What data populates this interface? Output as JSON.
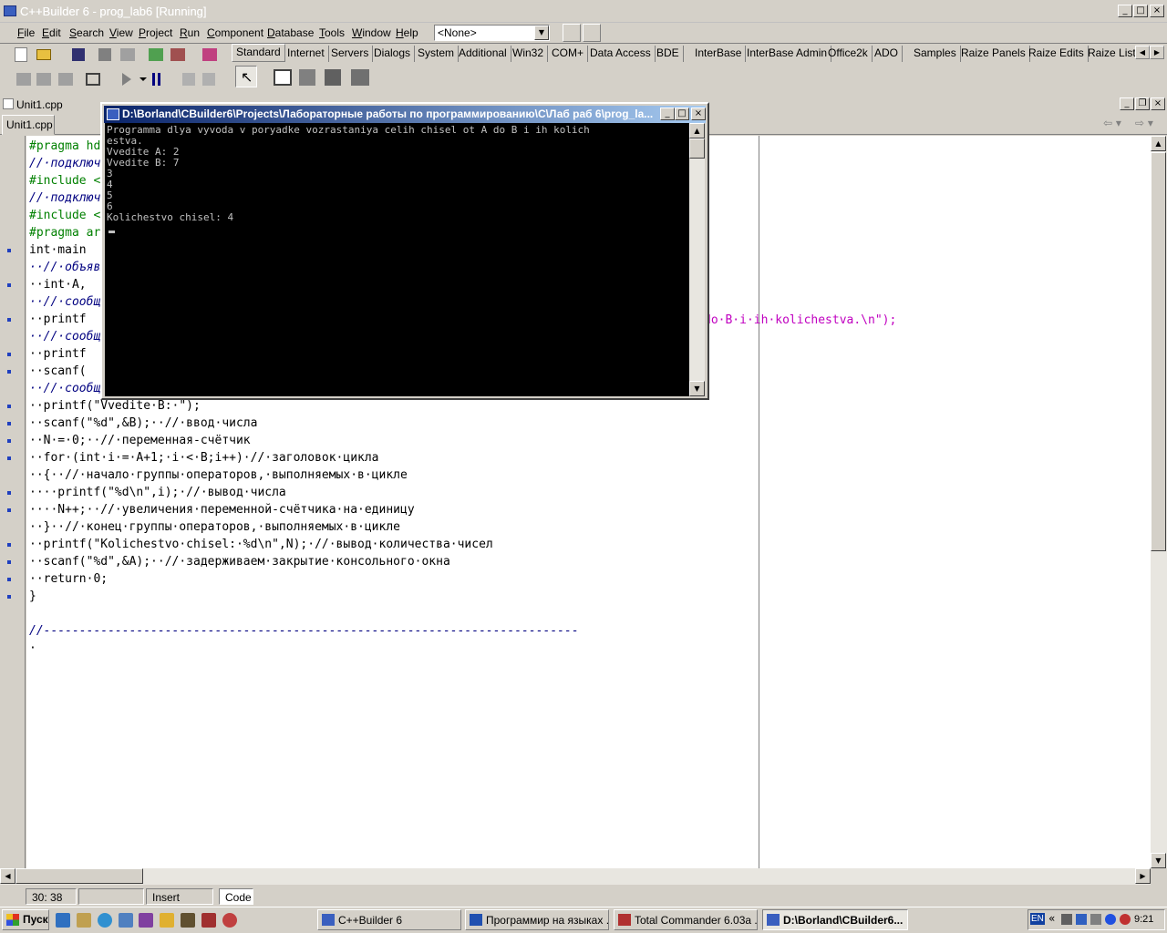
{
  "window": {
    "title": "C++Builder 6 - prog_lab6 [Running]"
  },
  "menu": [
    "File",
    "Edit",
    "Search",
    "View",
    "Project",
    "Run",
    "Component",
    "Database",
    "Tools",
    "Window",
    "Help"
  ],
  "config_combo": "<None>",
  "palette_tabs": [
    "Standard",
    "Internet",
    "Servers",
    "Dialogs",
    "System",
    "Additional",
    "Win32",
    "COM+",
    "Data Access",
    "BDE",
    "InterBase",
    "InterBase Admin",
    "Office2k",
    "ADO",
    "Samples",
    "Raize Panels",
    "Raize Edits",
    "Raize Lists"
  ],
  "editor": {
    "title": "Unit1.cpp",
    "tab": "Unit1.cpp",
    "lines": [
      {
        "t": "#pragma hdrstop",
        "c": "dir",
        "bp": false
      },
      {
        "t": "//·подключение",
        "c": "com",
        "bp": false
      },
      {
        "t": "#include <stdio.h>",
        "c": "dir",
        "bp": false
      },
      {
        "t": "//·подключение",
        "c": "com",
        "bp": false
      },
      {
        "t": "#include <conio.h>",
        "c": "dir",
        "bp": false
      },
      {
        "t": "#pragma argsused",
        "c": "dir",
        "bp": false
      },
      {
        "t": "int·main",
        "c": "norm",
        "bp": true
      },
      {
        "t": "··//·объявление",
        "c": "com",
        "bp": false
      },
      {
        "t": "··int·A,",
        "c": "norm",
        "bp": true
      },
      {
        "t": "··//·сообщение",
        "c": "com",
        "bp": false
      },
      {
        "t": "··printf",
        "c": "norm",
        "bp": true
      },
      {
        "t": "··//·сообщение",
        "c": "com",
        "bp": false
      },
      {
        "t": "··printf",
        "c": "norm",
        "bp": true
      },
      {
        "t": "··scanf(",
        "c": "norm",
        "bp": true
      },
      {
        "t": "··//·сообщение",
        "c": "com",
        "bp": false
      },
      {
        "t": "··printf(\"Vvedite·B:·\");",
        "c": "norm",
        "bp": true
      },
      {
        "t": "··scanf(\"%d\",&B);··//·ввод·числа",
        "c": "norm",
        "bp": true
      },
      {
        "t": "··N·=·0;··//·переменная-счётчик",
        "c": "norm",
        "bp": true
      },
      {
        "t": "··for·(int·i·=·A+1;·i·<·B;i++)·//·заголовок·цикла",
        "c": "norm",
        "bp": true
      },
      {
        "t": "··{··//·начало·группы·операторов,·выполняемых·в·цикле",
        "c": "norm",
        "bp": false
      },
      {
        "t": "····printf(\"%d\\n\",i);·//·вывод·числа",
        "c": "norm",
        "bp": true
      },
      {
        "t": "····N++;··//·увеличения·переменной-счётчика·на·единицу",
        "c": "norm",
        "bp": true
      },
      {
        "t": "··}··//·конец·группы·операторов,·выполняемых·в·цикле",
        "c": "norm",
        "bp": false
      },
      {
        "t": "··printf(\"Kolichestvo·chisel:·%d\\n\",N);·//·вывод·количества·чисел",
        "c": "norm",
        "bp": true
      },
      {
        "t": "··scanf(\"%d\",&A);··//·задерживаем·закрытие·консольного·окна",
        "c": "norm",
        "bp": true
      },
      {
        "t": "··return·0;",
        "c": "norm",
        "bp": true
      },
      {
        "t": "}",
        "c": "norm",
        "bp": true
      },
      {
        "t": "",
        "c": "norm",
        "bp": false
      },
      {
        "t": "//---------------------------------------------------------------------------",
        "c": "com",
        "bp": false
      },
      {
        "t": "·",
        "c": "norm",
        "bp": false
      }
    ],
    "overflow_text": "do·B·i·ih·kolichestva.\\n\");"
  },
  "console": {
    "title": "D:\\Borland\\CBuilder6\\Projects\\Лабораторные работы по программированию\\C\\Лаб раб 6\\prog_la...",
    "lines": [
      "Programma dlya vyvoda v poryadke vozrastaniya celih chisel ot A do B i ih kolich",
      "estva.",
      "Vvedite A: 2",
      "Vvedite B: 7",
      "3",
      "4",
      "5",
      "6",
      "Kolichestvo chisel: 4"
    ]
  },
  "status": {
    "position": "30: 38",
    "modified": "",
    "mode": "Insert",
    "tab": "Code"
  },
  "taskbar": {
    "start": "Пуск",
    "tasks": [
      "C++Builder 6",
      "Программир на языках ...",
      "Total Commander 6.03a ...",
      "D:\\Borland\\CBuilder6..."
    ],
    "lang": "EN",
    "clock": "9:21"
  },
  "colors": {
    "console_title_start": "#0a246a",
    "console_title_end": "#a6caf0",
    "directive": "#008000",
    "string": "#c000c0",
    "comment": "#000080"
  }
}
